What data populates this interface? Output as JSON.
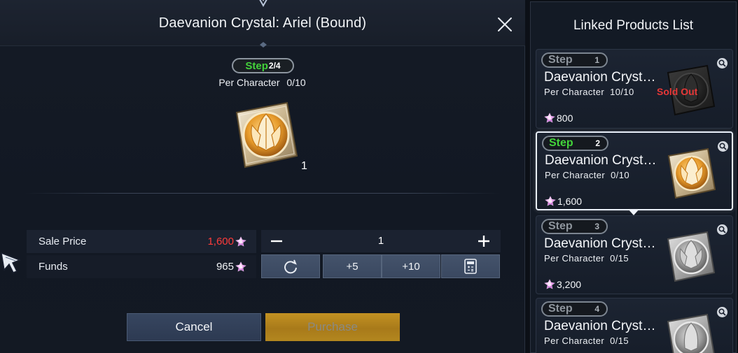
{
  "dialog": {
    "title": "Daevanion Crystal: Ariel (Bound)",
    "step_word": "Step",
    "step_value": "2/4",
    "limit_label": "Per Character",
    "limit_value": "0/10",
    "item_quantity": "1"
  },
  "price": {
    "sale_label": "Sale Price",
    "sale_value": "1,600",
    "funds_label": "Funds",
    "funds_value": "965"
  },
  "stepper": {
    "minus_symbol": "−",
    "plus_symbol": "+",
    "quantity": "1"
  },
  "buttons": {
    "plus5": "+5",
    "plus10": "+10",
    "cancel": "Cancel",
    "purchase": "Purchase"
  },
  "side_panel": {
    "title": "Linked Products List",
    "cards": [
      {
        "step_word": "Step",
        "step_num": "1",
        "name": "Daevanion Cryst…",
        "limit_label": "Per Character",
        "limit_value": "10/10",
        "status": "Sold Out",
        "price": "800",
        "icon": "crystal-dark"
      },
      {
        "step_word": "Step",
        "step_num": "2",
        "name": "Daevanion Cryst…",
        "limit_label": "Per Character",
        "limit_value": "0/10",
        "price": "1,600",
        "icon": "crystal-gold"
      },
      {
        "step_word": "Step",
        "step_num": "3",
        "name": "Daevanion Cryst…",
        "limit_label": "Per Character",
        "limit_value": "0/15",
        "price": "3,200",
        "icon": "crystal-silver"
      },
      {
        "step_word": "Step",
        "step_num": "4",
        "name": "Daevanion Cryst…",
        "limit_label": "Per Character",
        "limit_value": "0/15",
        "icon": "crystal-silver"
      }
    ]
  },
  "colors": {
    "step_green": "#43d33a",
    "price_red": "#ff3b3b",
    "sold_out_red": "#e63737",
    "purchase_gold": "#c39222",
    "button_blue": "#3a4860"
  }
}
